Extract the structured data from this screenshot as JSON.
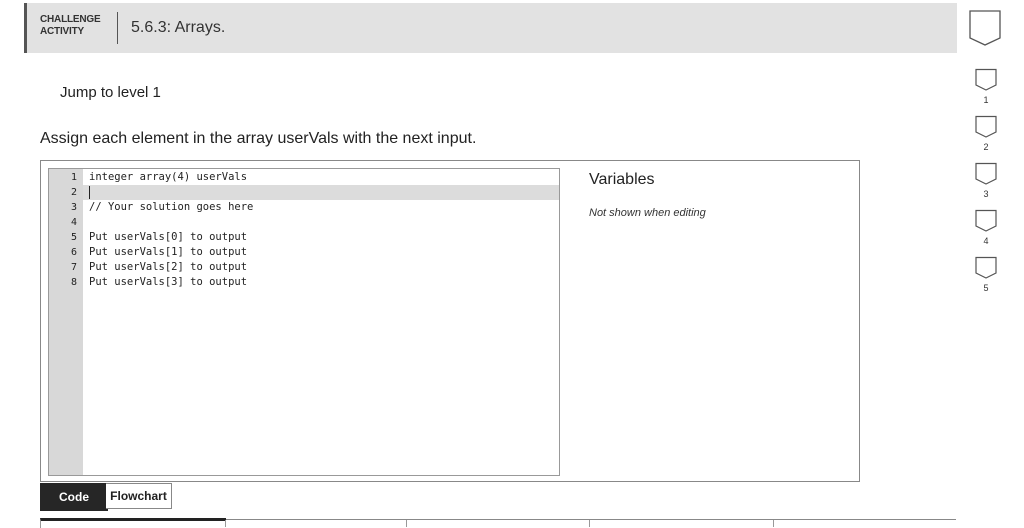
{
  "header": {
    "label_line1": "CHALLENGE",
    "label_line2": "ACTIVITY",
    "title": "5.6.3: Arrays."
  },
  "jump_link": "Jump to level 1",
  "instructions": "Assign each element in the array userVals with the next input.",
  "editor": {
    "line_numbers": [
      "1",
      "2",
      "3",
      "4",
      "5",
      "6",
      "7",
      "8"
    ],
    "lines": [
      "integer array(4) userVals",
      "",
      "// Your solution goes here",
      "",
      "Put userVals[0] to output",
      "Put userVals[1] to output",
      "Put userVals[2] to output",
      "Put userVals[3] to output"
    ]
  },
  "variables": {
    "title": "Variables",
    "note": "Not shown when editing"
  },
  "view_tabs": {
    "code": "Code",
    "flowchart": "Flowchart"
  },
  "levels": [
    "1",
    "2",
    "3",
    "4",
    "5"
  ],
  "colors": {
    "header_bg": "#e2e2e2",
    "active_tab_bg": "#262626",
    "gutter_bg": "#d8d8d8"
  }
}
